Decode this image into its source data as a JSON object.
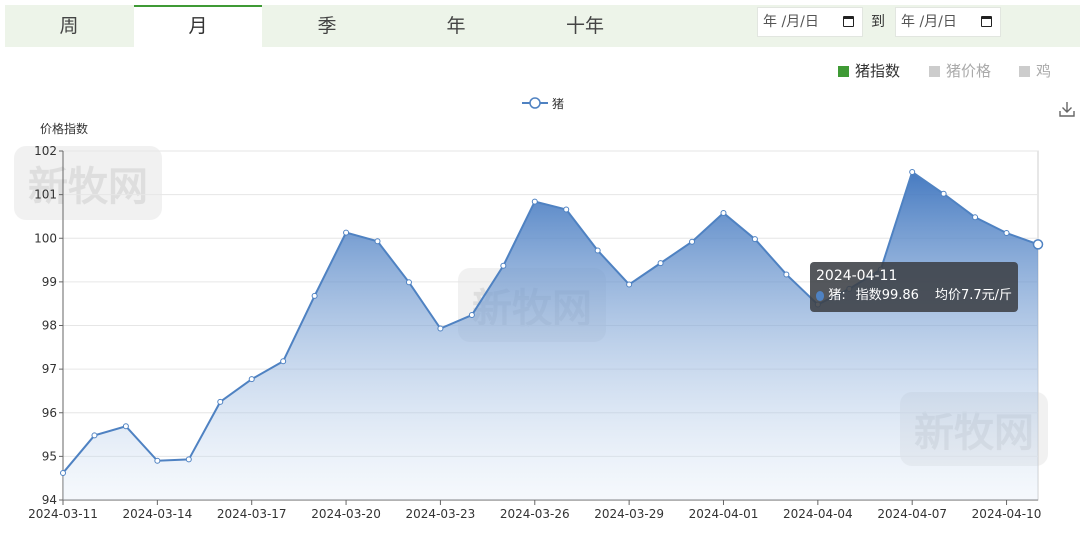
{
  "tabs": [
    {
      "label": "周"
    },
    {
      "label": "月"
    },
    {
      "label": "季"
    },
    {
      "label": "年"
    },
    {
      "label": "十年"
    }
  ],
  "date_range": {
    "start_placeholder": "年 /月/日",
    "end_placeholder": "年 /月/日",
    "separator": "到"
  },
  "filters": [
    {
      "label": "猪指数",
      "color": "#3f9a35"
    },
    {
      "label": "猪价格",
      "color": "#cccccc"
    },
    {
      "label": "鸡",
      "color": "#cccccc"
    }
  ],
  "watermark": "新牧网",
  "tooltip": {
    "date": "2024-04-11",
    "series": "猪:",
    "index_text": "指数99.86",
    "price_text": "均价7.7元/斤"
  },
  "chart_data": {
    "type": "area",
    "ylabel": "价格指数",
    "ylim": [
      94,
      102
    ],
    "yticks": [
      94,
      95,
      96,
      97,
      98,
      99,
      100,
      101,
      102
    ],
    "xtick_labels": [
      "2024-03-11",
      "2024-03-14",
      "2024-03-17",
      "2024-03-20",
      "2024-03-23",
      "2024-03-26",
      "2024-03-29",
      "2024-04-01",
      "2024-04-04",
      "2024-04-07",
      "2024-04-10"
    ],
    "legend": "top",
    "series": [
      {
        "name": "猪",
        "color": "#4f82c2",
        "x": [
          "2024-03-11",
          "2024-03-12",
          "2024-03-13",
          "2024-03-14",
          "2024-03-15",
          "2024-03-16",
          "2024-03-17",
          "2024-03-18",
          "2024-03-19",
          "2024-03-20",
          "2024-03-21",
          "2024-03-22",
          "2024-03-23",
          "2024-03-24",
          "2024-03-25",
          "2024-03-26",
          "2024-03-27",
          "2024-03-28",
          "2024-03-29",
          "2024-03-30",
          "2024-03-31",
          "2024-04-01",
          "2024-04-02",
          "2024-04-03",
          "2024-04-04",
          "2024-04-05",
          "2024-04-06",
          "2024-04-07",
          "2024-04-08",
          "2024-04-09",
          "2024-04-10",
          "2024-04-11"
        ],
        "values": [
          94.62,
          95.48,
          95.69,
          94.9,
          94.93,
          96.25,
          96.77,
          97.18,
          98.68,
          100.13,
          99.93,
          98.99,
          97.93,
          98.24,
          99.37,
          100.84,
          100.66,
          99.72,
          98.94,
          99.43,
          99.92,
          100.58,
          99.98,
          99.17,
          98.48,
          98.84,
          99.28,
          101.52,
          101.02,
          100.48,
          100.12,
          99.86
        ]
      }
    ]
  }
}
